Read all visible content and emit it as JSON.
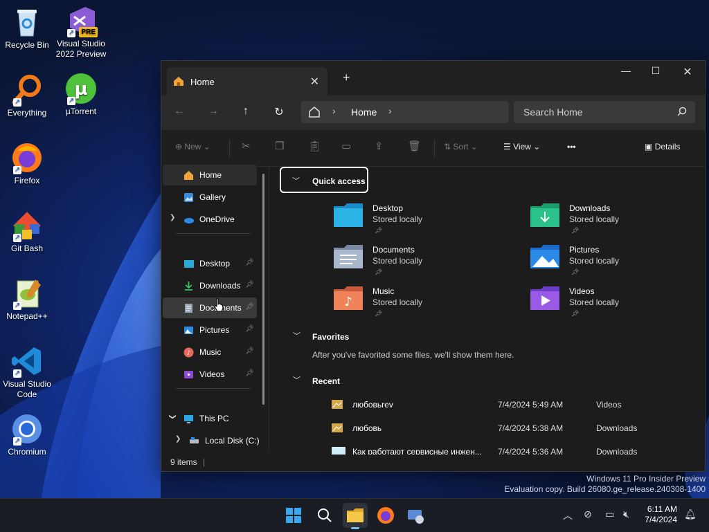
{
  "desktop": {
    "icons": [
      {
        "label1": "Recycle Bin",
        "label2": ""
      },
      {
        "label1": "Visual Studio",
        "label2": "2022 Preview"
      },
      {
        "label1": "Everything",
        "label2": ""
      },
      {
        "label1": "µTorrent",
        "label2": ""
      },
      {
        "label1": "Firefox",
        "label2": ""
      },
      {
        "label1": "Git Bash",
        "label2": ""
      },
      {
        "label1": "Notepad++",
        "label2": ""
      },
      {
        "label1": "Visual Studio",
        "label2": "Code"
      },
      {
        "label1": "Chromium",
        "label2": ""
      }
    ],
    "vs_badge": "PRE"
  },
  "explorer": {
    "tab_label": "Home",
    "address": "Home",
    "search_placeholder": "Search Home",
    "toolbar": {
      "new": "New",
      "sort": "Sort",
      "view": "View",
      "more": "•••",
      "details": "Details"
    },
    "sidebar": [
      {
        "label": "Home"
      },
      {
        "label": "Gallery"
      },
      {
        "label": "OneDrive"
      },
      {
        "label": "Desktop"
      },
      {
        "label": "Downloads"
      },
      {
        "label": "Documents"
      },
      {
        "label": "Pictures"
      },
      {
        "label": "Music"
      },
      {
        "label": "Videos"
      },
      {
        "label": "This PC"
      },
      {
        "label": "Local Disk (C:)"
      }
    ],
    "quick_access_title": "Quick access",
    "folders": [
      {
        "name": "Desktop",
        "status": "Stored locally"
      },
      {
        "name": "Downloads",
        "status": "Stored locally"
      },
      {
        "name": "Documents",
        "status": "Stored locally"
      },
      {
        "name": "Pictures",
        "status": "Stored locally"
      },
      {
        "name": "Music",
        "status": "Stored locally"
      },
      {
        "name": "Videos",
        "status": "Stored locally"
      }
    ],
    "favorites_title": "Favorites",
    "favorites_empty": "After you've favorited some files, we'll show them here.",
    "recent_title": "Recent",
    "recent": [
      {
        "name": "любовьrev",
        "date": "7/4/2024 5:49 AM",
        "location": "Videos"
      },
      {
        "name": "любовь",
        "date": "7/4/2024 5:38 AM",
        "location": "Downloads"
      },
      {
        "name": "Как работают сервисные инжен...",
        "date": "7/4/2024 5:36 AM",
        "location": "Downloads"
      }
    ],
    "status": "9 items"
  },
  "watermark": {
    "line1": "Windows 11 Pro Insider Preview",
    "line2": "Evaluation copy. Build 26080.ge_release.240308-1400"
  },
  "taskbar": {
    "time": "6:11 AM",
    "date": "7/4/2024"
  },
  "colors": {
    "accent": "#0078d4",
    "window_bg": "#1c1c1c"
  }
}
